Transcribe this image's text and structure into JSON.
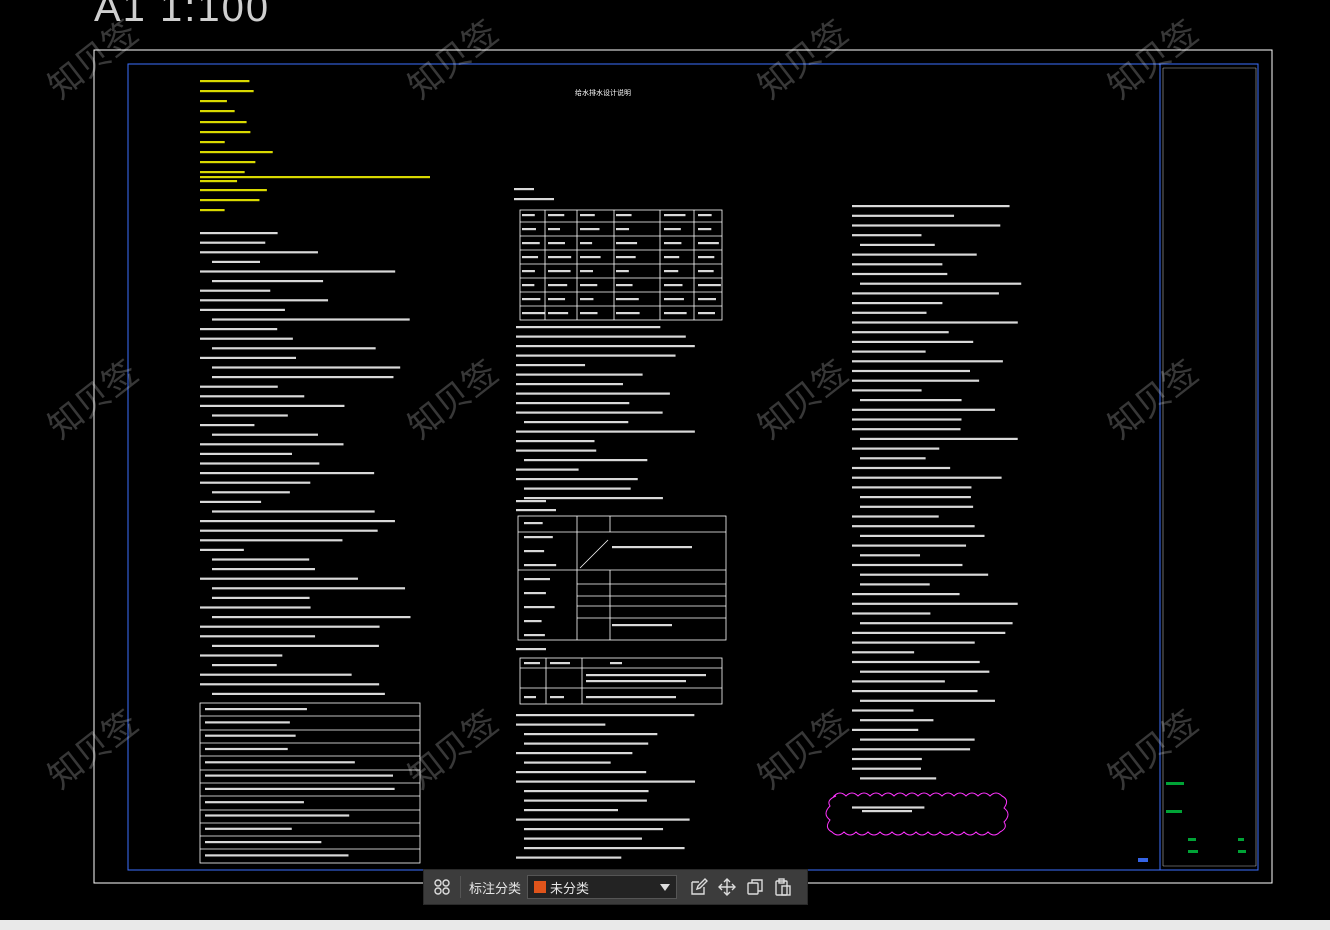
{
  "drawing": {
    "scale_label": "A1 1:100",
    "watermark_text": "知贝签",
    "sheet_title": "给水排水设计说明"
  },
  "toolbar": {
    "annotation_category_label": "标注分类",
    "category_value": "未分类",
    "category_color": "#e0541b",
    "icons": [
      "grid-icon",
      "edit-icon",
      "move-icon",
      "copy-icon",
      "paste-icon"
    ]
  },
  "colors": {
    "background": "#000000",
    "frame_outer": "#ffffff",
    "frame_inner": "#3b6fff",
    "text_yellow": "#ffff00",
    "text_white": "#ffffff",
    "revision_cloud": "#ff33ff",
    "toolbar_bg": "#3c3c3c"
  }
}
